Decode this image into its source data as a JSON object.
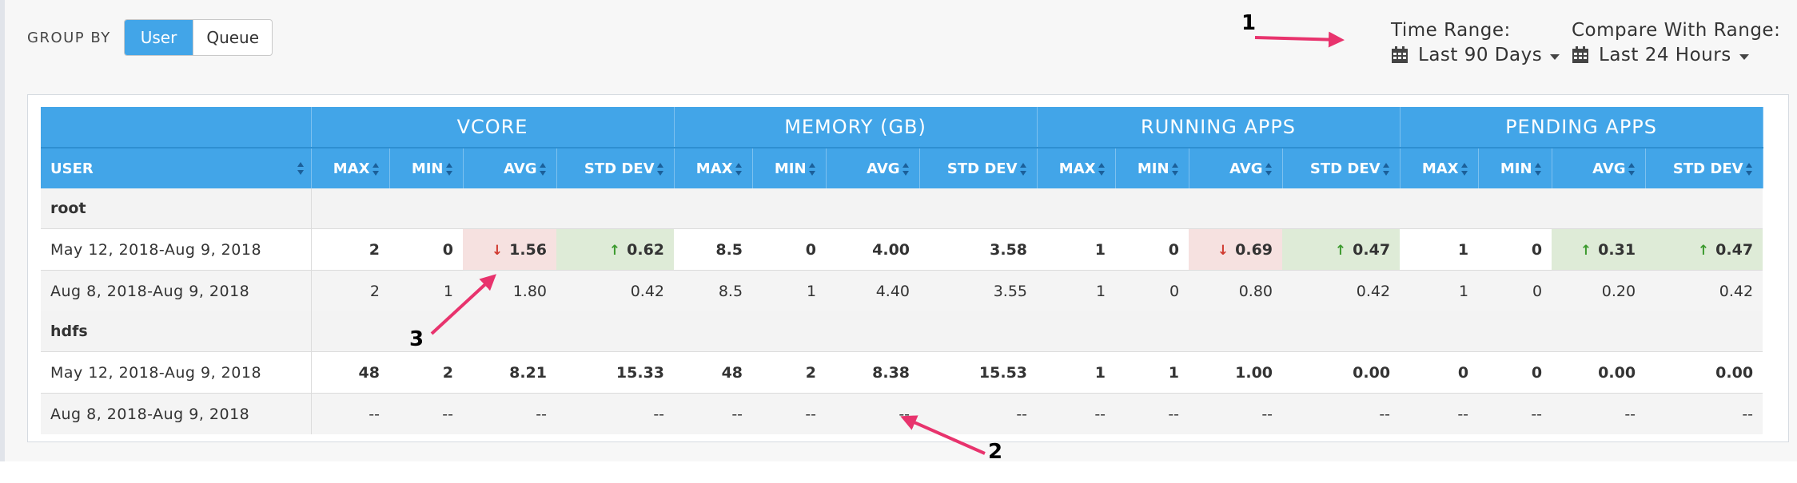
{
  "group_by": {
    "label": "GROUP BY",
    "options": [
      "User",
      "Queue"
    ],
    "active": "User"
  },
  "time_range": {
    "label": "Time Range:",
    "value": "Last 90 Days"
  },
  "compare_range": {
    "label": "Compare With Range:",
    "value": "Last 24 Hours"
  },
  "annotations": [
    "1",
    "2",
    "3"
  ],
  "colors": {
    "header_blue": "#42a5e8",
    "annotation_arrow": "#e8336d",
    "decrease_bg": "#f6e1e0",
    "increase_bg": "#deebd7",
    "decrease_arrow": "#d0392f",
    "increase_arrow": "#3c9a2e"
  },
  "table": {
    "user_header": "USER",
    "groups": [
      "VCORE",
      "MEMORY (GB)",
      "RUNNING APPS",
      "PENDING APPS"
    ],
    "sub_headers": [
      "MAX",
      "MIN",
      "AVG",
      "STD DEV"
    ],
    "sections": [
      {
        "name": "root",
        "rows": [
          {
            "period": "May 12, 2018-Aug 9, 2018",
            "kind": "current",
            "cells": [
              "2",
              "0",
              "1.56",
              "0.62",
              "8.5",
              "0",
              "4.00",
              "3.58",
              "1",
              "0",
              "0.69",
              "0.47",
              "1",
              "0",
              "0.31",
              "0.47"
            ],
            "trend": [
              "",
              "",
              "down",
              "up",
              "",
              "",
              "",
              "",
              "",
              "",
              "down",
              "up",
              "",
              "",
              "up",
              "up"
            ]
          },
          {
            "period": "Aug 8, 2018-Aug 9, 2018",
            "kind": "prev",
            "cells": [
              "2",
              "1",
              "1.80",
              "0.42",
              "8.5",
              "1",
              "4.40",
              "3.55",
              "1",
              "0",
              "0.80",
              "0.42",
              "1",
              "0",
              "0.20",
              "0.42"
            ],
            "trend": [
              "",
              "",
              "",
              "",
              "",
              "",
              "",
              "",
              "",
              "",
              "",
              "",
              "",
              "",
              "",
              ""
            ]
          }
        ]
      },
      {
        "name": "hdfs",
        "rows": [
          {
            "period": "May 12, 2018-Aug 9, 2018",
            "kind": "current",
            "cells": [
              "48",
              "2",
              "8.21",
              "15.33",
              "48",
              "2",
              "8.38",
              "15.53",
              "1",
              "1",
              "1.00",
              "0.00",
              "0",
              "0",
              "0.00",
              "0.00"
            ],
            "trend": [
              "",
              "",
              "",
              "",
              "",
              "",
              "",
              "",
              "",
              "",
              "",
              "",
              "",
              "",
              "",
              ""
            ]
          },
          {
            "period": "Aug 8, 2018-Aug 9, 2018",
            "kind": "prev",
            "cells": [
              "--",
              "--",
              "--",
              "--",
              "--",
              "--",
              "--",
              "--",
              "--",
              "--",
              "--",
              "--",
              "--",
              "--",
              "--",
              "--"
            ],
            "trend": [
              "",
              "",
              "",
              "",
              "",
              "",
              "",
              "",
              "",
              "",
              "",
              "",
              "",
              "",
              "",
              ""
            ]
          }
        ]
      }
    ]
  }
}
